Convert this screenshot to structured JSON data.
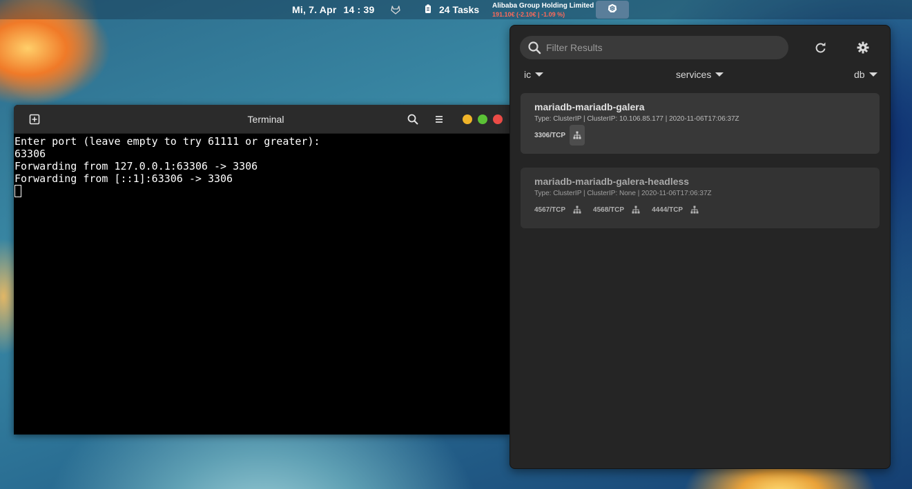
{
  "topbar": {
    "date": "Mi, 7. Apr",
    "time": "14 : 39",
    "tasks": "24 Tasks",
    "stock_name": "Alibaba Group Holding Limited",
    "stock_value": "191.10€  (-2.10€ | -1.09 %)",
    "icons": [
      "gitlab-icon",
      "todo-icon",
      "kubernetes-icon"
    ]
  },
  "terminal": {
    "title": "Terminal",
    "lines": [
      "Enter port (leave empty to try 61111 or greater):",
      "63306",
      "Forwarding from 127.0.0.1:63306 -> 3306",
      "Forwarding from [::1]:63306 -> 3306"
    ]
  },
  "kube": {
    "search_placeholder": "Filter Results",
    "context": "ic",
    "resource": "services",
    "namespace": "db",
    "services": [
      {
        "name": "mariadb-mariadb-galera",
        "meta": "Type: ClusterIP | ClusterIP: 10.106.85.177 | 2020-11-06T17:06:37Z",
        "ports": [
          "3306/TCP"
        ]
      },
      {
        "name": "mariadb-mariadb-galera-headless",
        "meta": "Type: ClusterIP | ClusterIP: None | 2020-11-06T17:06:37Z",
        "ports": [
          "4567/TCP",
          "4568/TCP",
          "4444/TCP"
        ]
      }
    ]
  },
  "colors": {
    "stock_negative": "#ff6a5a",
    "close": "#ec4c47",
    "maximize": "#5bc236",
    "minimize": "#f0b429"
  }
}
